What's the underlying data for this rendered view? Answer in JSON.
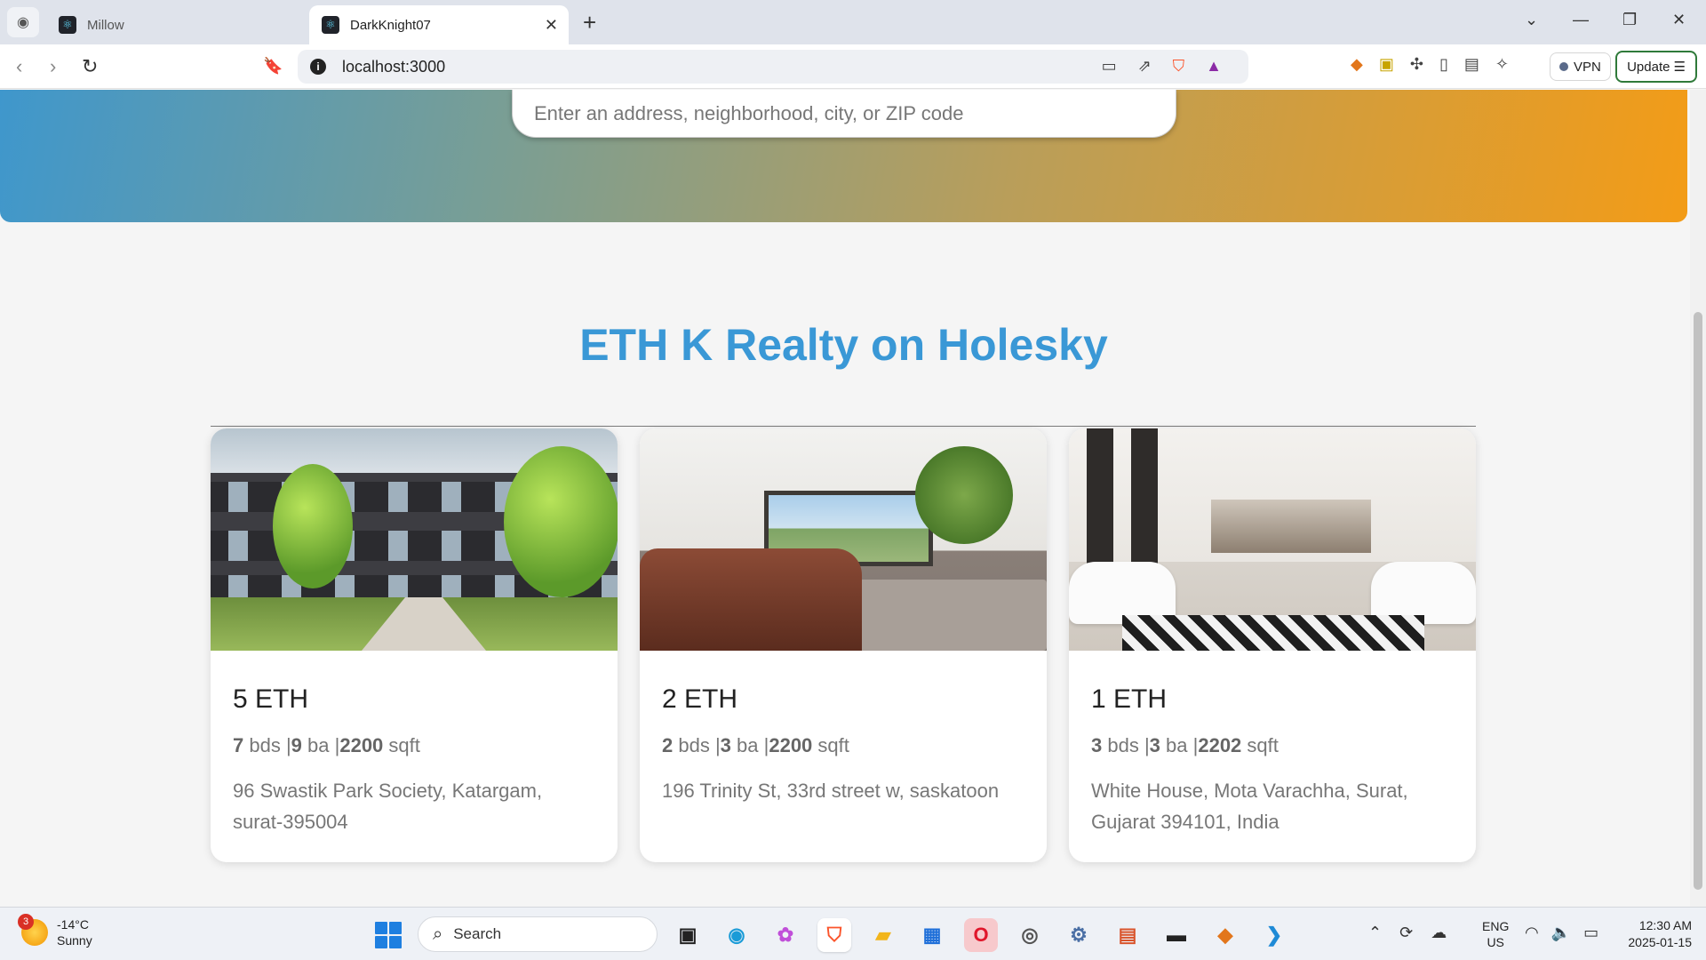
{
  "browser": {
    "tabs": [
      {
        "label": "Millow",
        "active": false
      },
      {
        "label": "DarkKnight07",
        "active": true
      }
    ],
    "url": "localhost:3000",
    "vpn_label": "VPN",
    "update_label": "Update"
  },
  "page": {
    "search_placeholder": "Enter an address, neighborhood, city, or ZIP code",
    "heading": "ETH K Realty on Holesky",
    "colors": {
      "heading": "#3a98d6",
      "hero_start": "#3f97cc",
      "hero_end": "#f39c17"
    },
    "listings": [
      {
        "price": "5 ETH",
        "beds": "7",
        "beds_unit": " bds |",
        "baths": "9",
        "baths_unit": " ba |",
        "sqft": "2200",
        "sqft_unit": " sqft",
        "address": "96 Swastik Park Society, Katargam, surat-395004",
        "image": "townhouse-exterior"
      },
      {
        "price": "2 ETH",
        "beds": "2",
        "beds_unit": " bds |",
        "baths": "3",
        "baths_unit": " ba |",
        "sqft": "2200",
        "sqft_unit": " sqft",
        "address": "196 Trinity St, 33rd street w, saskatoon",
        "image": "living-room"
      },
      {
        "price": "1 ETH",
        "beds": "3",
        "beds_unit": " bds |",
        "baths": "3",
        "baths_unit": " ba |",
        "sqft": "2202",
        "sqft_unit": " sqft",
        "address": "White House, Mota Varachha, Surat, Gujarat 394101, India",
        "image": "luxury-interior"
      }
    ]
  },
  "taskbar": {
    "weather": {
      "temp": "-14°C",
      "condition": "Sunny",
      "badge": "3"
    },
    "search_label": "Search",
    "lang_top": "ENG",
    "lang_bottom": "US",
    "time": "12:30 AM",
    "date": "2025-01-15"
  }
}
